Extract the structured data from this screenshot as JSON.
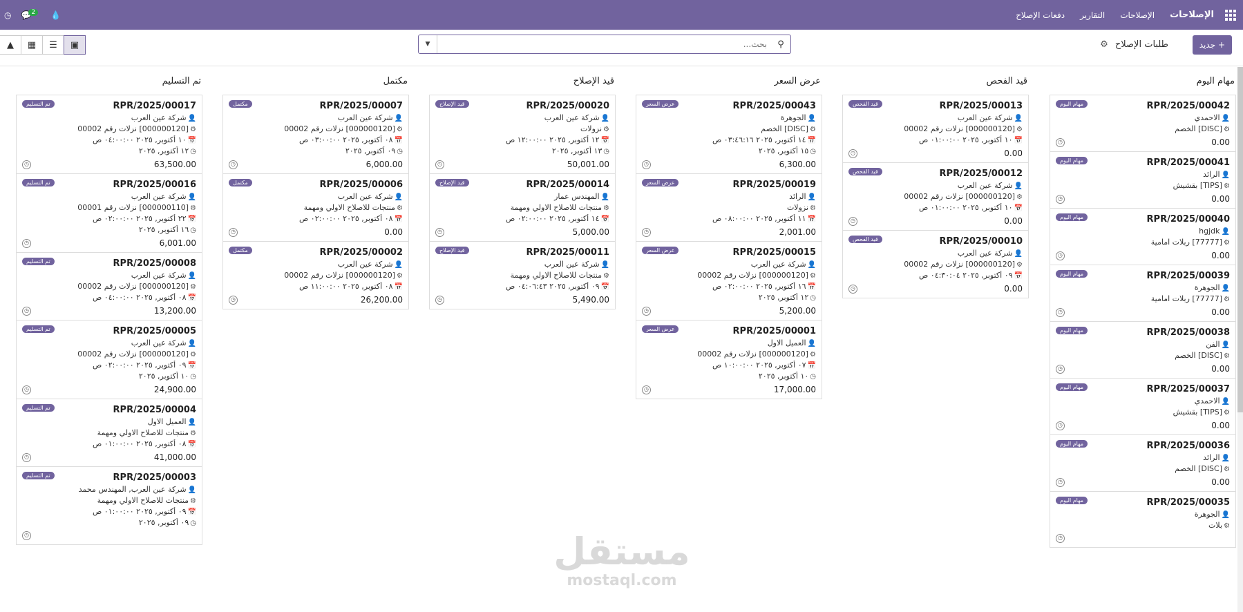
{
  "topbar": {
    "brand": "الإصلاحات",
    "menu": [
      "الإصلاحات",
      "التقارير",
      "دفعات الإصلاح"
    ],
    "chat_count": "2"
  },
  "controls": {
    "new_label": "جديد",
    "page_title": "طلبات الإصلاح",
    "search_placeholder": "بحث..."
  },
  "columns": [
    {
      "title": "مهام اليوم",
      "cards": [
        {
          "ref": "RPR/2025/00042",
          "tag": "مهام اليوم",
          "lines": [
            "الاحمدي",
            "[DISC] الخصم"
          ],
          "amount": "0.00"
        },
        {
          "ref": "RPR/2025/00041",
          "tag": "مهام اليوم",
          "lines": [
            "الرائد",
            "[TIPS] بقشيش"
          ],
          "amount": "0.00"
        },
        {
          "ref": "RPR/2025/00040",
          "tag": "مهام اليوم",
          "lines": [
            "hgjdk",
            "[77777] ربلات امامية"
          ],
          "amount": "0.00"
        },
        {
          "ref": "RPR/2025/00039",
          "tag": "مهام اليوم",
          "lines": [
            "الجوهرة",
            "[77777] ربلات امامية"
          ],
          "amount": "0.00"
        },
        {
          "ref": "RPR/2025/00038",
          "tag": "مهام اليوم",
          "lines": [
            "الفن",
            "[DISC] الخصم"
          ],
          "amount": "0.00"
        },
        {
          "ref": "RPR/2025/00037",
          "tag": "مهام اليوم",
          "lines": [
            "الاحمدي",
            "[TIPS] بقشيش"
          ],
          "amount": "0.00"
        },
        {
          "ref": "RPR/2025/00036",
          "tag": "مهام اليوم",
          "lines": [
            "الرائد",
            "[DISC] الخصم"
          ],
          "amount": "0.00"
        },
        {
          "ref": "RPR/2025/00035",
          "tag": "مهام اليوم",
          "lines": [
            "الجوهرة",
            "بلات"
          ],
          "amount": ""
        }
      ]
    },
    {
      "title": "قيد الفحص",
      "cards": [
        {
          "ref": "RPR/2025/00013",
          "tag": "قيد الفحص",
          "lines": [
            "شركة عين العرب",
            "[000000120] نزلات رقم 00002",
            "١٠ أكتوبر, ٢٠٢٥ ٠١:٠٠:٠٠ ص"
          ],
          "amount": "0.00"
        },
        {
          "ref": "RPR/2025/00012",
          "tag": "قيد الفحص",
          "lines": [
            "شركة عين العرب",
            "[000000120] نزلات رقم 00002",
            "١٠ أكتوبر, ٢٠٢٥ ٠١:٠٠:٠٠ ص"
          ],
          "amount": "0.00"
        },
        {
          "ref": "RPR/2025/00010",
          "tag": "قيد الفحص",
          "lines": [
            "شركة عين العرب",
            "[000000120] نزلات رقم 00002",
            "٠٩ أكتوبر, ٢٠٢٥ ٠٤:٣٠:٠٤ ص"
          ],
          "amount": "0.00"
        }
      ]
    },
    {
      "title": "عرض السعر",
      "cards": [
        {
          "ref": "RPR/2025/00043",
          "tag": "عرض السعر",
          "lines": [
            "الجوهرة",
            "[DISC] الخصم",
            "١٤ أكتوبر, ٢٠٢٥ ٠٣:٤٦:١٦ ص",
            "١٥ أكتوبر, ٢٠٢٥"
          ],
          "amount": "6,300.00"
        },
        {
          "ref": "RPR/2025/00019",
          "tag": "عرض السعر",
          "lines": [
            "الرائد",
            "نزولات",
            "١١ أكتوبر, ٢٠٢٥ ٠٨:٠٠:٠٠ ص"
          ],
          "amount": "2,001.00"
        },
        {
          "ref": "RPR/2025/00015",
          "tag": "عرض السعر",
          "lines": [
            "شركة عين العرب",
            "[000000120] نزلات رقم 00002",
            "١٦ أكتوبر, ٢٠٢٥ ٠٢:٠٠:٠٠ ص",
            "١٢ أكتوبر, ٢٠٢٥"
          ],
          "amount": "5,200.00"
        },
        {
          "ref": "RPR/2025/00001",
          "tag": "عرض السعر",
          "lines": [
            "العميل الاول",
            "[000000120] نزلات رقم 00002",
            "٠٧ أكتوبر, ٢٠٢٥ ١٠:٠٠:٠٠ ص",
            "١٠ أكتوبر, ٢٠٢٥"
          ],
          "amount": "17,000.00"
        }
      ]
    },
    {
      "title": "قيد الإصلاح",
      "cards": [
        {
          "ref": "RPR/2025/00020",
          "tag": "قيد الإصلاح",
          "lines": [
            "شركة عين العرب",
            "نزولات",
            "١٢ أكتوبر, ٢٠٢٥ ١٢:٠٠:٠٠ ص",
            "١٣ أكتوبر, ٢٠٢٥"
          ],
          "amount": "50,001.00"
        },
        {
          "ref": "RPR/2025/00014",
          "tag": "قيد الإصلاح",
          "lines": [
            "المهندس عمار",
            "منتجات للاصلاح الاولي ومهمة",
            "١٤ أكتوبر, ٢٠٢٥ ٠٢:٠٠:٠٠ ص"
          ],
          "amount": "5,000.00"
        },
        {
          "ref": "RPR/2025/00011",
          "tag": "قيد الإصلاح",
          "lines": [
            "شركة عين العرب",
            "منتجات للاصلاح الاولي ومهمة",
            "٠٩ أكتوبر, ٢٠٢٥ ٠٤:٠٦:٤٣ ص"
          ],
          "amount": "5,490.00"
        }
      ]
    },
    {
      "title": "مكتمل",
      "cards": [
        {
          "ref": "RPR/2025/00007",
          "tag": "مكتمل",
          "lines": [
            "شركة عين العرب",
            "[000000120] نزلات رقم 00002",
            "٠٨ أكتوبر, ٢٠٢٥ ٠٣:٠٠:٠٠ ص",
            "٠٩ أكتوبر, ٢٠٢٥"
          ],
          "amount": "6,000.00"
        },
        {
          "ref": "RPR/2025/00006",
          "tag": "مكتمل",
          "lines": [
            "شركة عين العرب",
            "منتجات للاصلاح الاولي ومهمة",
            "٠٨ أكتوبر, ٢٠٢٥ ٠٢:٠٠:٠٠ ص"
          ],
          "amount": "0.00"
        },
        {
          "ref": "RPR/2025/00002",
          "tag": "مكتمل",
          "lines": [
            "شركة عين العرب",
            "[000000120] نزلات رقم 00002",
            "٠٨ أكتوبر, ٢٠٢٥ ١١:٠٠:٠٠ ص"
          ],
          "amount": "26,200.00"
        }
      ]
    },
    {
      "title": "تم التسليم",
      "cards": [
        {
          "ref": "RPR/2025/00017",
          "tag": "تم التسليم",
          "lines": [
            "شركة عين العرب",
            "[000000120] نزلات رقم 00002",
            "١٠ أكتوبر, ٢٠٢٥ ٠٤:٠٠:٠٠ ص",
            "١٢ أكتوبر, ٢٠٢٥"
          ],
          "amount": "63,500.00"
        },
        {
          "ref": "RPR/2025/00016",
          "tag": "تم التسليم",
          "lines": [
            "شركة عين العرب",
            "[000000110] نزلات رقم 00001",
            "٢٢ أكتوبر, ٢٠٢٥ ٠٢:٠٠:٠٠ ص",
            "١٦ أكتوبر, ٢٠٢٥"
          ],
          "amount": "6,001.00"
        },
        {
          "ref": "RPR/2025/00008",
          "tag": "تم التسليم",
          "lines": [
            "شركة عين العرب",
            "[000000120] نزلات رقم 00002",
            "٠٨ أكتوبر, ٢٠٢٥ ٠٤:٠٠:٠٠ ص"
          ],
          "amount": "13,200.00"
        },
        {
          "ref": "RPR/2025/00005",
          "tag": "تم التسليم",
          "lines": [
            "شركة عين العرب",
            "[000000120] نزلات رقم 00002",
            "٠٩ أكتوبر, ٢٠٢٥ ٠٢:٠٠:٠٠ ص",
            "١٠ أكتوبر, ٢٠٢٥"
          ],
          "amount": "24,900.00"
        },
        {
          "ref": "RPR/2025/00004",
          "tag": "تم التسليم",
          "lines": [
            "العميل الاول",
            "منتجات للاصلاح الاولي ومهمة",
            "٠٨ أكتوبر, ٢٠٢٥ ٠١:٠٠:٠٠ ص"
          ],
          "amount": "41,000.00"
        },
        {
          "ref": "RPR/2025/00003",
          "tag": "تم التسليم",
          "lines": [
            "شركة عين العرب, المهندس محمد",
            "منتجات للاصلاح الاولي ومهمة",
            "٠٩ أكتوبر, ٢٠٢٥ ٠١:٠٠:٠٠ ص",
            "٠٩ أكتوبر, ٢٠٢٥"
          ],
          "amount": ""
        }
      ]
    }
  ],
  "watermark": {
    "arabic": "مستقل",
    "latin": "mostaql.com"
  }
}
